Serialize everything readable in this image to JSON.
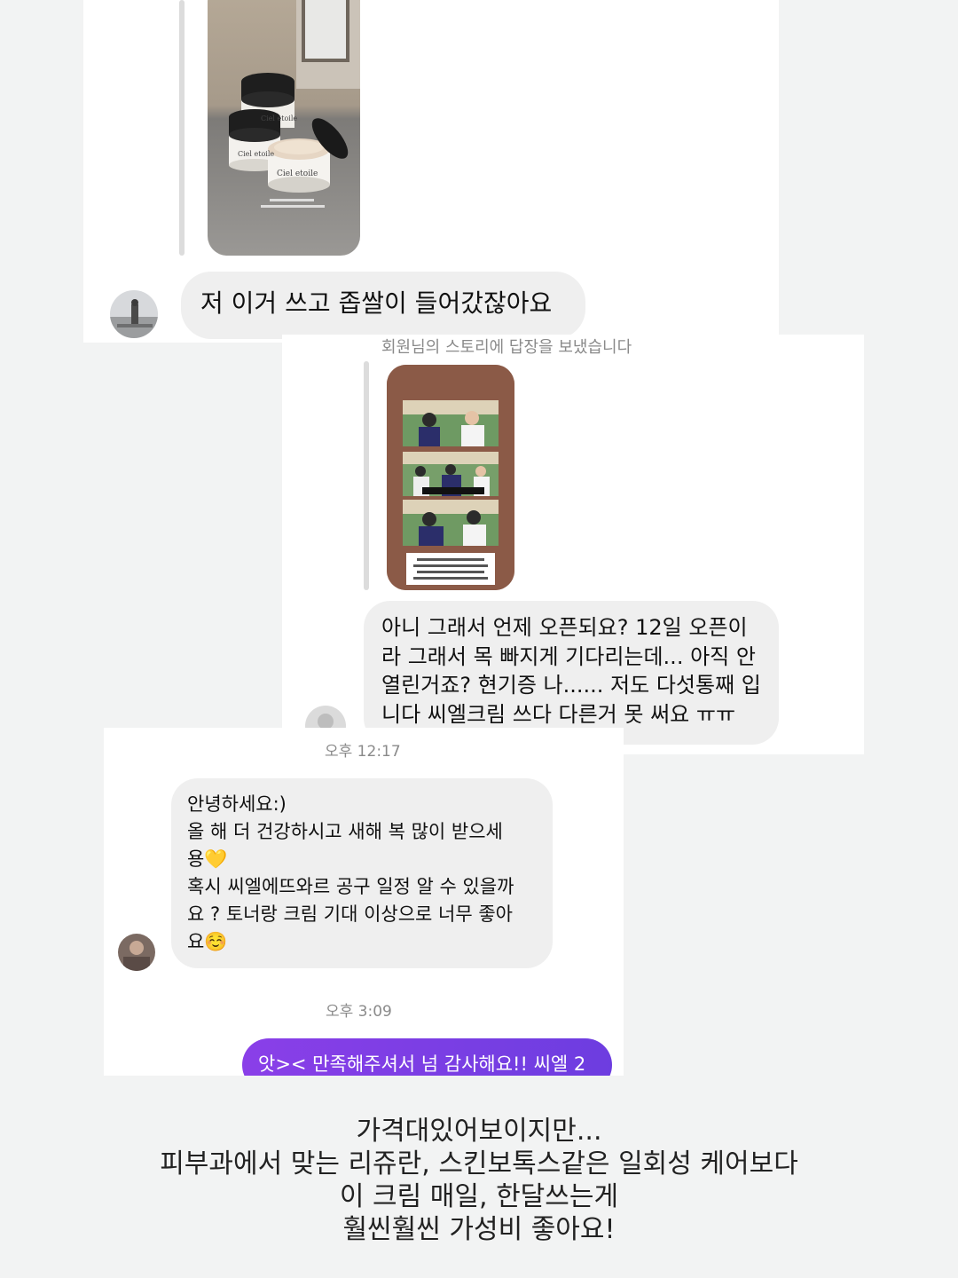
{
  "chat1": {
    "story_product_text": "Ciel etoile",
    "message": "저 이거 쓰고 좁쌀이 들어갔잖아요"
  },
  "chat2": {
    "story_reply_label": "회원님의 스토리에 답장을 보냈습니다",
    "message_lines": [
      "아니 그래서 언제 오픈되요?  12일 오픈이",
      "라 그래서 목 빠지게 기다리는데... 아직 안",
      "열린거죠? 현기증 나...... 저도 다섯통째 입",
      "니다 씨엘크림 쓰다 다른거 못 써요 ㅠㅠ"
    ]
  },
  "chat3": {
    "time1": "오후 12:17",
    "message_lines": [
      "안녕하세요:)",
      "올 해 더 건강하시고 새해 복 많이 받으세",
      "용💛",
      "혹시 씨엘에뜨와르 공구 일정 알 수 있을까",
      "요 ? 토너랑 크림 기대 이상으로 너무 좋아",
      "요☺️"
    ],
    "time2": "오후 3:09",
    "sent_message": "앗>< 만족해주셔서 넘 감사해요!! 씨엘 2"
  },
  "caption": {
    "lines": [
      "가격대있어보이지만...",
      "피부과에서 맞는 리쥬란, 스킨보톡스같은 일회성 케어보다",
      "이 크림 매일, 한달쓰는게",
      "훨씬훨씬 가성비 좋아요!"
    ]
  },
  "colors": {
    "bubble_received": "#efefef",
    "bubble_sent": "#7c3aed",
    "timestamp": "#8a8a8a",
    "background": "#f2f3f3"
  }
}
